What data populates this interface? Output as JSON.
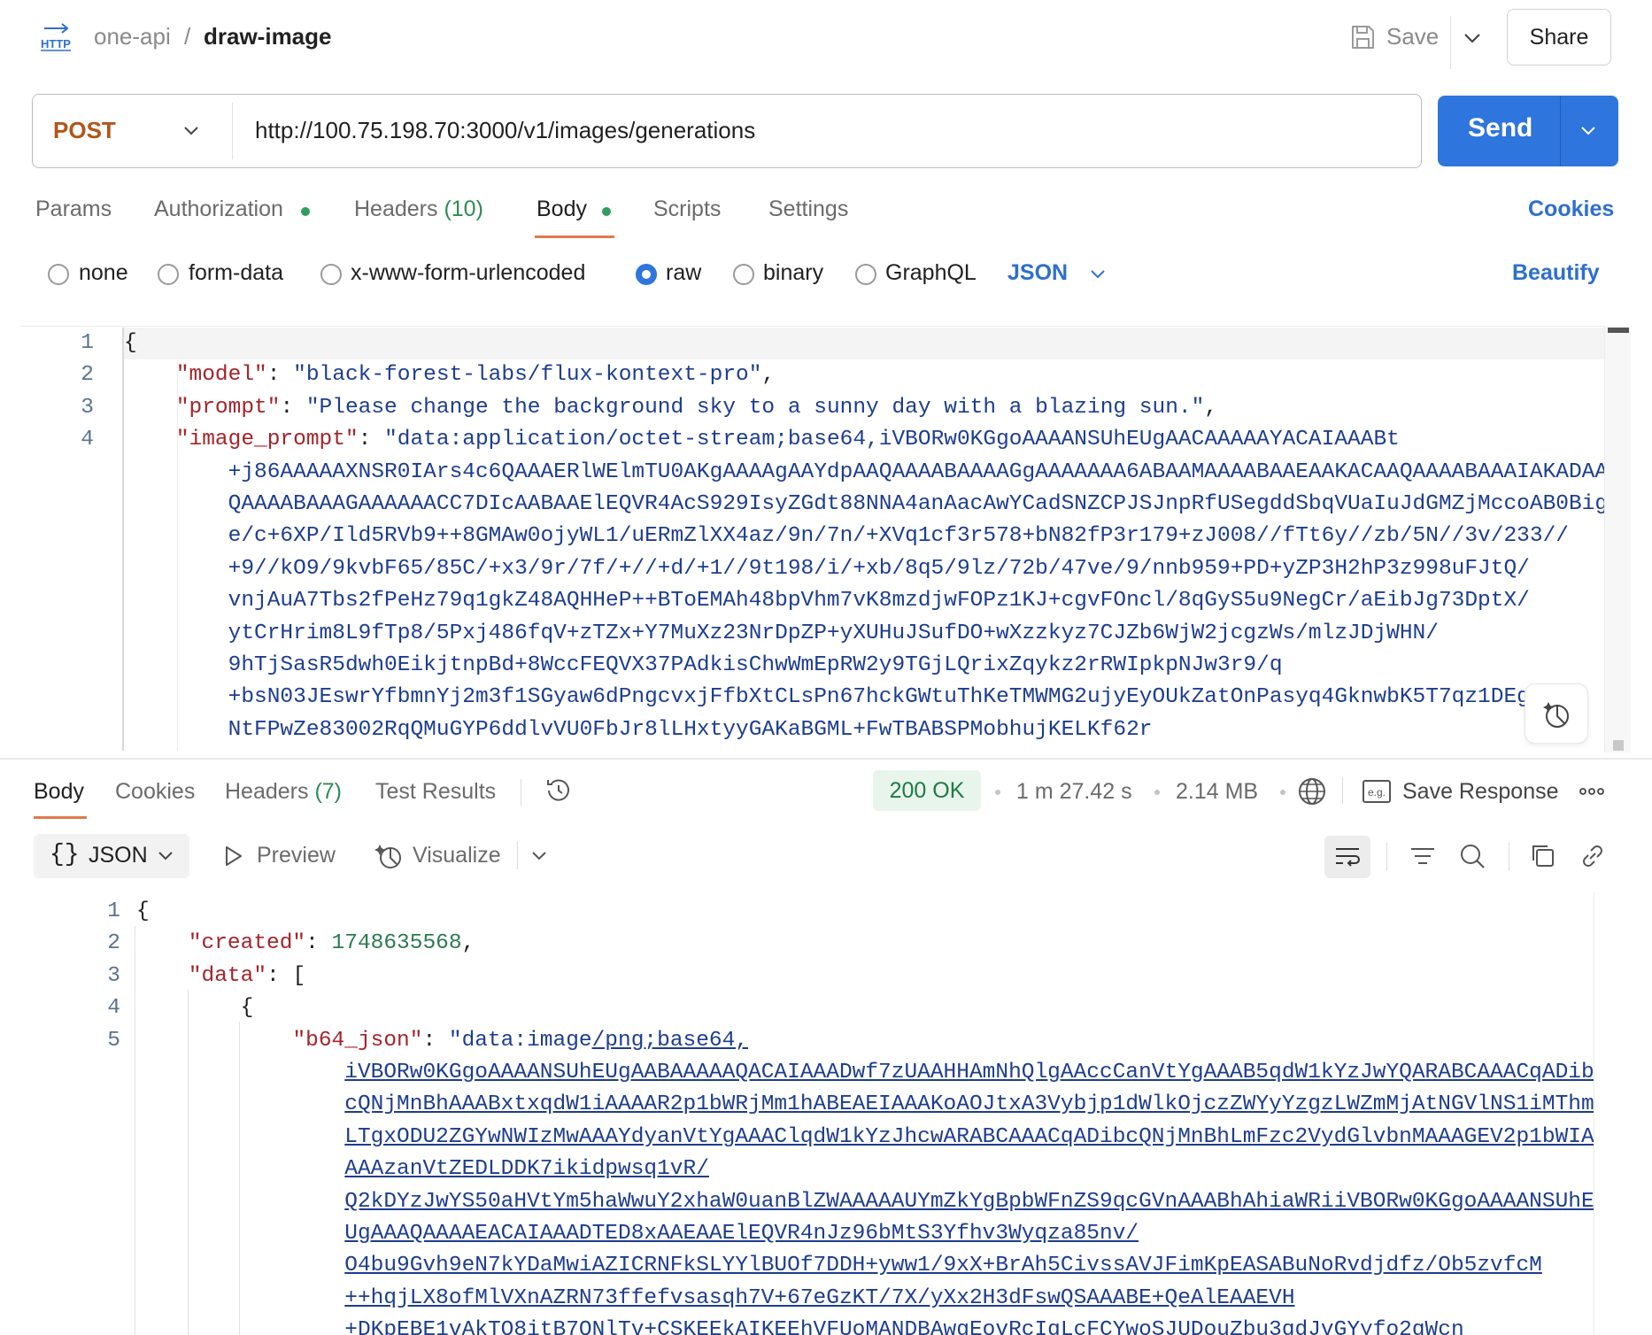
{
  "breadcrumb": {
    "parent": "one-api",
    "separator": "/",
    "current": "draw-image"
  },
  "header": {
    "save_label": "Save",
    "share_label": "Share"
  },
  "request": {
    "method": "POST",
    "url": "http://100.75.198.70:3000/v1/images/generations",
    "send_label": "Send"
  },
  "request_tabs": {
    "params": "Params",
    "authorization": "Authorization",
    "headers": "Headers",
    "headers_count": "(10)",
    "body": "Body",
    "scripts": "Scripts",
    "settings": "Settings",
    "cookies": "Cookies",
    "active": "Body"
  },
  "body_types": {
    "options": [
      "none",
      "form-data",
      "x-www-form-urlencoded",
      "raw",
      "binary",
      "GraphQL"
    ],
    "selected": "raw",
    "language": "JSON",
    "beautify": "Beautify"
  },
  "request_body": {
    "line_numbers": [
      "1",
      "2",
      "3",
      "4"
    ],
    "open_brace": "{",
    "model_key": "\"model\"",
    "model_value": "\"black-forest-labs/flux-kontext-pro\"",
    "prompt_key": "\"prompt\"",
    "prompt_value": "\"Please change the background sky to a sunny day with a blazing sun.\"",
    "image_prompt_key": "\"image_prompt\"",
    "image_prompt_lines": [
      "\"data:application/octet-stream;base64,iVBORw0KGgoAAAANSUhEUgAACAAAAAYACAIAAABt",
      "+j86AAAAAXNSR0IArs4c6QAAAERlWElmTU0AKgAAAAgAAYdpAAQAAAABAAAAGgAAAAAAA6ABAAMAAAABAAEAAKACAAQAAAABAAAIAKADAA",
      "QAAAABAAAGAAAAAACC7DIcAABAAElEQVR4AcS929IsyZGdt88NNA4anAacAwYCadSNZCPJSJnpRfUSegddSbqVUaIuJdGMZjMccoAB0Big",
      "e/c+6XP/Ild5RVb9++8GMAw0ojyWL1/uERmZlXX4az/9n/7n/+XVq1cf3r578+bN82fP3r179+zJ008//fTt6y//zb/5N//3v/233//",
      "+9//kO9/9kvbF65/85C/+x3/9r/7f/+//+d/+1//9t198/i/+xb/8q5/9lz/72b/47ve/9/nnb959+PD+yZP3H2hP3z998uFJtQ/",
      "vnjAuA7Tbs2fPeHz79q1gkZ48AQHHeP++BToEMAh48bpVhm7vK8mzdjwFOPz1KJ+cgvFOncl/8qGyS5u9NegCr/aEibJg73DptX/",
      "ytCrHrim8L9fTp8/5Pxj486fqV+zTZx+Y7MuXz23NrDpZP+yXUHuJSufDO+wXzzkyz7CJZb6WjW2jcgzWs/mlzJDjWHN/",
      "9hTjSasR5dwh0EikjtnpBd+8WccFEQVX37PAdkisChwWmEpRW2y9TGjLQrixZqykz2rRWIpkpNJw3r9/q",
      "+bsN03JEswrYfbmnYj2m3f1SGyaw6dPngcvxjFfbXtCLsPn67hckGWtuThKeTMWMG2ujyEyOUkZatOnPasyq4GknwbK5T7qz1DEg",
      "NtFPwZe83002RqQMuGYP6ddlvVU0FbJr8lLHxtyyGAKaBGML+FwTBABSPMobhujKELKf62r"
    ]
  },
  "response_tabs": {
    "body": "Body",
    "cookies": "Cookies",
    "headers": "Headers",
    "headers_count": "(7)",
    "test_results": "Test Results",
    "active": "Body"
  },
  "response_meta": {
    "status": "200 OK",
    "time": "1 m 27.42 s",
    "size": "2.14 MB",
    "save_response": "Save Response"
  },
  "response_toolbar": {
    "format_braces": "{}",
    "format_label": "JSON",
    "preview_label": "Preview",
    "visualize_label": "Visualize"
  },
  "response_body": {
    "line_numbers": [
      "1",
      "2",
      "3",
      "4",
      "5"
    ],
    "open_brace": "{",
    "created_key": "\"created\"",
    "created_value": "1748635568",
    "data_key": "\"data\"",
    "open_bracket": "[",
    "inner_brace": "{",
    "b64_key": "\"b64_json\"",
    "b64_prefix": "\"data:image",
    "b64_link_first": "/png;base64,",
    "b64_lines": [
      "iVBORw0KGgoAAAANSUhEUgAABAAAAAQACAIAAADwf7zUAAHHAmNhQlgAAccCanVtYgAAAB5qdW1kYzJwYQARABCAAACqADib",
      "cQNjMnBhAAABxtxqdW1iAAAAR2p1bWRjMm1hABEAEIAAAKoAOJtxA3Vybjp1dWlkOjczZWYyYzgzLWZmMjAtNGVlNS1iMThm",
      "LTgxODU2ZGYwNWIzMwAAAYdyanVtYgAAAClqdW1kYzJhcwARABCAAACqADibcQNjMnBhLmFzc2VydGlvbnMAAAGEV2p1bWIA",
      "AAAzanVtZEDLDDK7ikidpwsq1vR/",
      "Q2kDYzJwYS50aHVtYm5haWwuY2xhaW0uanBlZWAAAAAUYmZkYgBpbWFnZS9qcGVnAAABhAhiaWRiiVBORw0KGgoAAAANSUhE",
      "UgAAAQAAAAEACAIAAADTED8xAAEAAElEQVR4nJz96bMtS3Yfhv3Wyqza85nv/",
      "O4bu9Gvh9eN7kYDaMwiAZICRNFkSLYYlBUOf7DDH+yww1/9xX+BrAh5CivssAVJFimKpEASABuNoRvdjdfz/Ob5zvfcM",
      "++hqjLX8ofMlVXnAZRN73ffefvsasqh7V+67eGzKT/7X/yXx2H3dFswQSAAABE+QeAlEAAEVH",
      "+DKpEBE1vAkTQ8itB7QNlTv+CSKEEkAIKEEhVFUoMANDBAwgEovRcIqLcFCYwoSJUDouZbu3qdJvGYyfo2qWcn"
    ]
  },
  "colors": {
    "accent_blue": "#2e75dd",
    "method_orange": "#b2551b",
    "status_green": "#1f7a45",
    "json_key": "#a4242a",
    "json_string": "#1d3d8f",
    "json_number": "#2c7a52"
  },
  "icons": {
    "http": "http-request-icon",
    "save": "floppy-disk-icon",
    "history": "history-clock-icon",
    "globe": "globe-icon",
    "example": "example-eg-icon",
    "more": "ellipsis-icon",
    "preview": "play-triangle-icon",
    "visualize": "visualize-sparkle-icon",
    "wrap": "wrap-lines-icon",
    "filter": "filter-icon",
    "search": "search-icon",
    "copy": "copy-icon",
    "link": "link-icon"
  }
}
